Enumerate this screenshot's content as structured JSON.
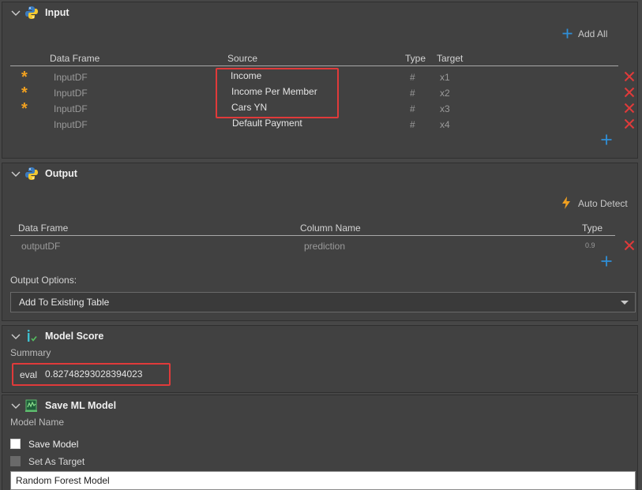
{
  "colors": {
    "accent_blue": "#2f8fd8",
    "danger_red": "#e03a3a",
    "star_orange": "#f0a020",
    "highlight_box": "#e03a3a"
  },
  "input_panel": {
    "title": "Input",
    "icon": "python-icon",
    "add_all_label": "Add All",
    "columns": {
      "data_frame": "Data Frame",
      "source": "Source",
      "type": "Type",
      "target": "Target"
    },
    "rows": [
      {
        "required": true,
        "data_frame": "InputDF",
        "source": "Income",
        "type": "#",
        "target": "x1"
      },
      {
        "required": true,
        "data_frame": "InputDF",
        "source": "Income Per Member",
        "type": "#",
        "target": "x2"
      },
      {
        "required": true,
        "data_frame": "InputDF",
        "source": "Cars YN",
        "type": "#",
        "target": "x3"
      },
      {
        "required": false,
        "data_frame": "InputDF",
        "source": "Default Payment",
        "type": "#",
        "target": "x4"
      }
    ]
  },
  "output_panel": {
    "title": "Output",
    "icon": "python-icon",
    "auto_detect_label": "Auto Detect",
    "columns": {
      "data_frame": "Data Frame",
      "column_name": "Column Name",
      "type": "Type"
    },
    "rows": [
      {
        "data_frame": "outputDF",
        "column_name": "prediction",
        "type": "0.9"
      }
    ],
    "options_label": "Output Options:",
    "options_selected": "Add To Existing Table"
  },
  "model_score_panel": {
    "title": "Model Score",
    "icon": "score-icon",
    "summary_label": "Summary",
    "metric_name": "eval",
    "metric_value": "0.82748293028394023"
  },
  "save_model_panel": {
    "title": "Save ML Model",
    "icon": "ml-model-icon",
    "model_name_label": "Model Name",
    "save_model_label": "Save Model",
    "set_as_target_label": "Set As Target",
    "model_name_value": "Random Forest Model"
  }
}
